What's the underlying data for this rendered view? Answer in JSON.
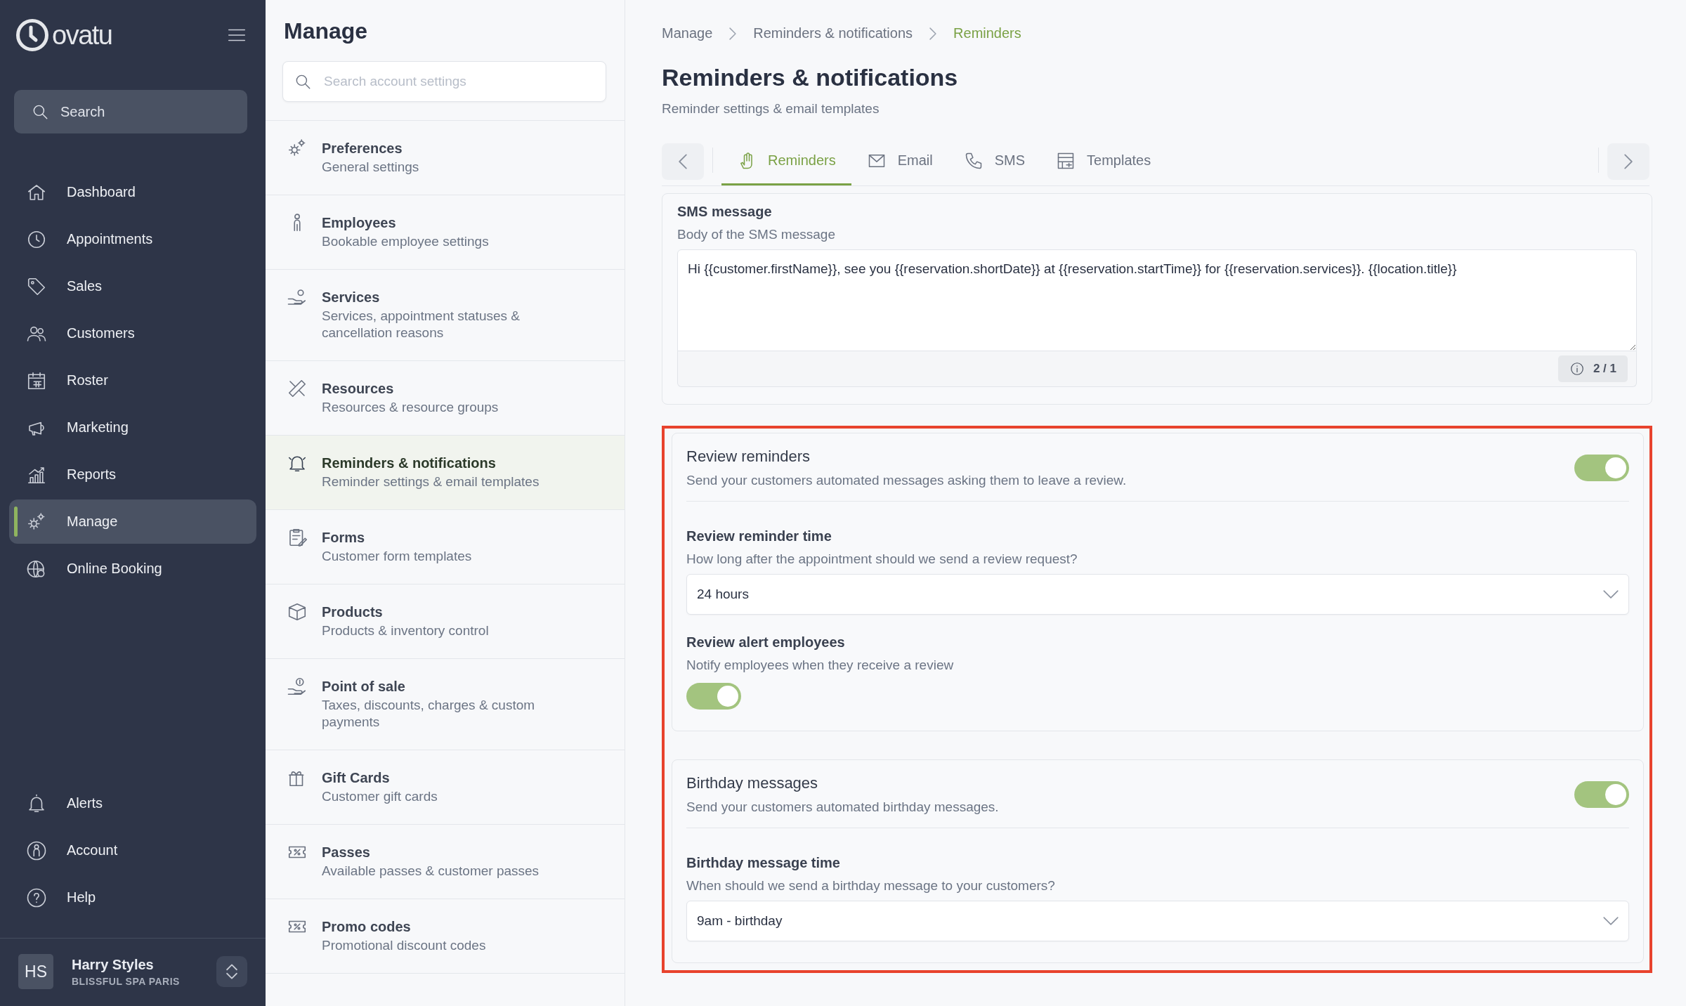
{
  "sidebar": {
    "logo": "ovatu",
    "search": {
      "placeholder": "Search"
    },
    "nav": [
      {
        "label": "Dashboard",
        "selected": false
      },
      {
        "label": "Appointments",
        "selected": false
      },
      {
        "label": "Sales",
        "selected": false
      },
      {
        "label": "Customers",
        "selected": false
      },
      {
        "label": "Roster",
        "selected": false
      },
      {
        "label": "Marketing",
        "selected": false
      },
      {
        "label": "Reports",
        "selected": false
      },
      {
        "label": "Manage",
        "selected": true
      },
      {
        "label": "Online Booking",
        "selected": false
      }
    ],
    "bottom_nav": [
      {
        "label": "Alerts"
      },
      {
        "label": "Account"
      },
      {
        "label": "Help"
      }
    ],
    "user": {
      "initials": "HS",
      "name": "Harry Styles",
      "business": "BLISSFUL SPA PARIS"
    }
  },
  "settings_panel": {
    "title": "Manage",
    "search": {
      "placeholder": "Search account settings"
    },
    "items": [
      {
        "title": "Preferences",
        "subtitle": "General settings",
        "selected": false
      },
      {
        "title": "Employees",
        "subtitle": "Bookable employee settings",
        "selected": false
      },
      {
        "title": "Services",
        "subtitle": "Services, appointment statuses & cancellation reasons",
        "selected": false
      },
      {
        "title": "Resources",
        "subtitle": "Resources & resource groups",
        "selected": false
      },
      {
        "title": "Reminders & notifications",
        "subtitle": "Reminder settings & email templates",
        "selected": true
      },
      {
        "title": "Forms",
        "subtitle": "Customer form templates",
        "selected": false
      },
      {
        "title": "Products",
        "subtitle": "Products & inventory control",
        "selected": false
      },
      {
        "title": "Point of sale",
        "subtitle": "Taxes, discounts, charges & custom payments",
        "selected": false
      },
      {
        "title": "Gift Cards",
        "subtitle": "Customer gift cards",
        "selected": false
      },
      {
        "title": "Passes",
        "subtitle": "Available passes & customer passes",
        "selected": false
      },
      {
        "title": "Promo codes",
        "subtitle": "Promotional discount codes",
        "selected": false
      }
    ]
  },
  "main": {
    "breadcrumb": [
      "Manage",
      "Reminders & notifications",
      "Reminders"
    ],
    "title": "Reminders & notifications",
    "subtitle": "Reminder settings & email templates",
    "tabs": [
      {
        "label": "Reminders",
        "selected": true
      },
      {
        "label": "Email",
        "selected": false
      },
      {
        "label": "SMS",
        "selected": false
      },
      {
        "label": "Templates",
        "selected": false
      }
    ],
    "sms_card": {
      "label": "SMS message",
      "hint": "Body of the SMS message",
      "value": "Hi {{customer.firstName}}, see you {{reservation.shortDate}} at {{reservation.startTime}} for {{reservation.services}}. {{location.title}}",
      "counter": "2 / 1"
    },
    "sections": [
      {
        "title": "Review reminders",
        "description": "Send your customers automated messages asking them to leave a review.",
        "on": true,
        "fields": [
          {
            "kind": "select",
            "label": "Review reminder time",
            "hint": "How long after the appointment should we send a review request?",
            "value": "24 hours"
          },
          {
            "kind": "toggle",
            "label": "Review alert employees",
            "hint": "Notify employees when they receive a review",
            "on": true
          }
        ]
      },
      {
        "title": "Birthday messages",
        "description": "Send your customers automated birthday messages.",
        "on": true,
        "fields": [
          {
            "kind": "select",
            "label": "Birthday message time",
            "hint": "When should we send a birthday message to your customers?",
            "value": "9am - birthday"
          }
        ]
      }
    ]
  }
}
